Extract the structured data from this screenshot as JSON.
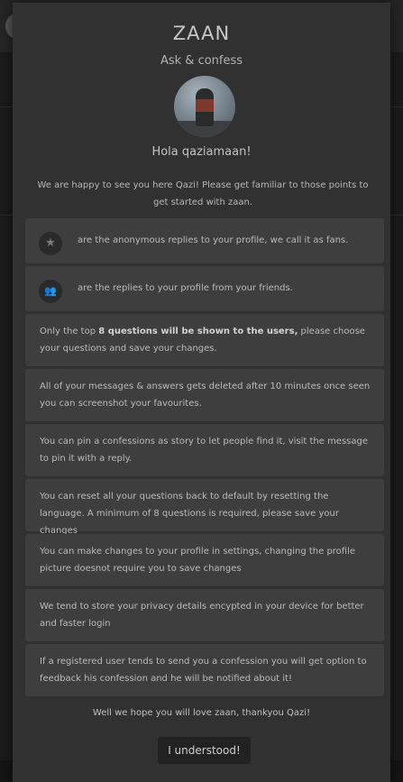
{
  "header": {
    "app_name": "ZAAN",
    "tagline": "Ask & confess"
  },
  "profile": {
    "greeting": "Hola qaziamaan!"
  },
  "intro": "We are happy to see you here Qazi! Please get familiar to those points to get started with zaan.",
  "points": [
    {
      "icon": "star-icon",
      "glyph": "★",
      "text": "are the anonymous replies to your profile, we call it as fans."
    },
    {
      "icon": "group-icon",
      "glyph": "👥",
      "text": "are the replies to your profile from your friends."
    },
    {
      "before": "Only the top ",
      "bold": "8 questions will be shown to the users,",
      "after": " please choose your questions and save your changes."
    },
    {
      "text": "All of your messages & answers gets deleted after 10 minutes once seen you can screenshot your favourites."
    },
    {
      "text": "You can pin a confessions as story to let people find it, visit the message to pin it with a reply."
    },
    {
      "text": "You can reset all your questions back to default by resetting the language. A minimum of 8 questions is required, please save your changes"
    },
    {
      "text": "You can make changes to your profile in settings, changing the profile picture doesnot require you to save changes"
    },
    {
      "text": "We tend to store your privacy details encypted in your device for better and faster login"
    },
    {
      "text": "If a registered user tends to send you a confession you will get option to feedback his confession and he will be notified about it!"
    }
  ],
  "outro": "Well we hope you will love zaan, thankyou Qazi!",
  "confirm_button": "I understood!"
}
